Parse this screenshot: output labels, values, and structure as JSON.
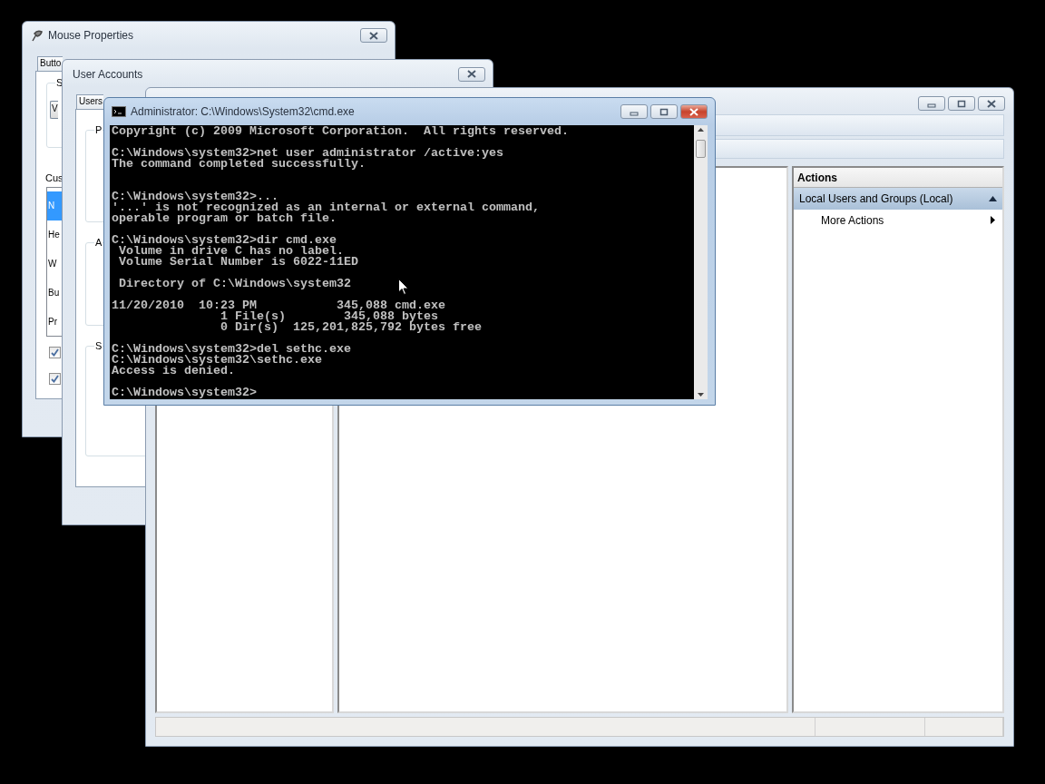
{
  "mouse_properties": {
    "title": "Mouse Properties",
    "tab": "Butto",
    "group_label": "S",
    "dropdown_value": "V",
    "list_label": "Cus",
    "list_items": [
      {
        "label": "N",
        "selected": true
      },
      {
        "label": "He",
        "selected": false
      },
      {
        "label": "W",
        "selected": false
      },
      {
        "label": "Bu",
        "selected": false
      },
      {
        "label": "Pr",
        "selected": false
      }
    ],
    "checkboxes": [
      {
        "checked": true
      },
      {
        "checked": true
      }
    ]
  },
  "user_accounts": {
    "title": "User Accounts",
    "tab": "Users",
    "group_labels": [
      "P",
      "A",
      "S"
    ]
  },
  "management_console": {
    "actions": {
      "header": "Actions",
      "sections": [
        {
          "label": "Local Users and Groups (Local)",
          "expanded": true,
          "items": [
            {
              "label": "More Actions"
            }
          ]
        }
      ]
    }
  },
  "console": {
    "title": "Administrator: C:\\Windows\\System32\\cmd.exe",
    "output": "Copyright (c) 2009 Microsoft Corporation.  All rights reserved.\n\nC:\\Windows\\system32>net user administrator /active:yes\nThe command completed successfully.\n\n\nC:\\Windows\\system32>...\n'...' is not recognized as an internal or external command,\noperable program or batch file.\n\nC:\\Windows\\system32>dir cmd.exe\n Volume in drive C has no label.\n Volume Serial Number is 6022-11ED\n\n Directory of C:\\Windows\\system32\n\n11/20/2010  10:23 PM           345,088 cmd.exe\n               1 File(s)        345,088 bytes\n               0 Dir(s)  125,201,825,792 bytes free\n\nC:\\Windows\\system32>del sethc.exe\nC:\\Windows\\system32\\sethc.exe\nAccess is denied.\n\nC:\\Windows\\system32>"
  }
}
